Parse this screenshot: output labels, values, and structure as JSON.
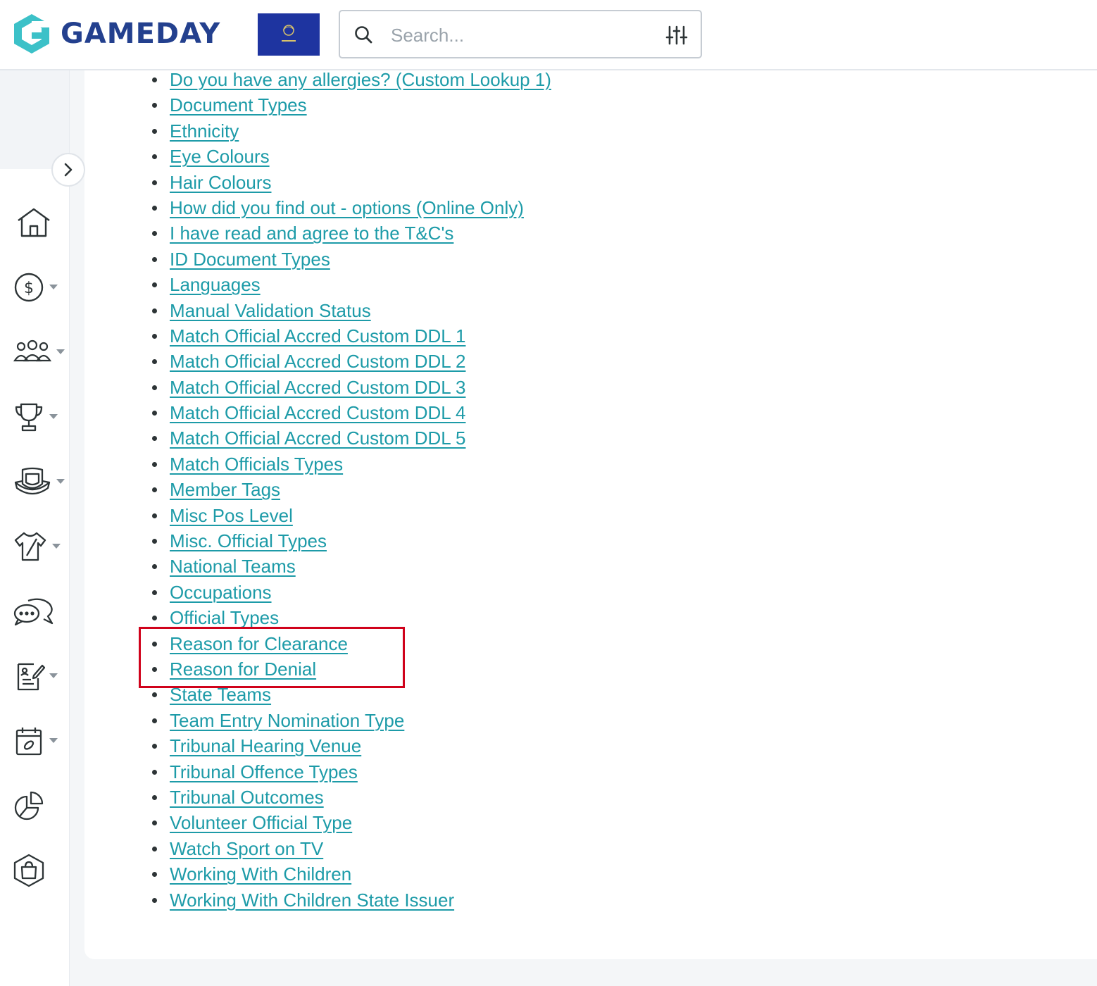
{
  "header": {
    "brand": "GAMEDAY",
    "search": {
      "placeholder": "Search...",
      "value": ""
    },
    "colors": {
      "brand": "#23408e",
      "accent": "#3cc1c8"
    }
  },
  "sidebar": {
    "toggle_icon": "chevron-right-icon",
    "items": [
      {
        "icon": "home-icon",
        "has_dropdown": false
      },
      {
        "icon": "dollar-icon",
        "has_dropdown": true
      },
      {
        "icon": "members-icon",
        "has_dropdown": true
      },
      {
        "icon": "trophy-icon",
        "has_dropdown": true
      },
      {
        "icon": "shield-icon",
        "has_dropdown": true
      },
      {
        "icon": "jersey-icon",
        "has_dropdown": true
      },
      {
        "icon": "chat-icon",
        "has_dropdown": false
      },
      {
        "icon": "form-icon",
        "has_dropdown": true
      },
      {
        "icon": "calendar-icon",
        "has_dropdown": true
      },
      {
        "icon": "pie-chart-icon",
        "has_dropdown": false
      },
      {
        "icon": "shopping-bag-icon",
        "has_dropdown": false
      }
    ]
  },
  "main": {
    "link_color": "#1d9ba8",
    "highlight_color": "#d0021b",
    "links": [
      "Do you have any allergies? (Custom Lookup 1)",
      "Document Types",
      "Ethnicity",
      "Eye Colours",
      "Hair Colours",
      "How did you find out - options (Online Only)",
      "I have read and agree to the T&C's",
      "ID Document Types",
      "Languages",
      "Manual Validation Status",
      "Match Official Accred Custom DDL 1",
      "Match Official Accred Custom DDL 2",
      "Match Official Accred Custom DDL 3",
      "Match Official Accred Custom DDL 4",
      "Match Official Accred Custom DDL 5",
      "Match Officials Types",
      "Member Tags",
      "Misc Pos Level",
      "Misc. Official Types",
      "National Teams",
      "Occupations",
      "Official Types",
      "Reason for Clearance",
      "Reason for Denial",
      "State Teams",
      "Team Entry Nomination Type",
      "Tribunal Hearing Venue",
      "Tribunal Offence Types",
      "Tribunal Outcomes",
      "Volunteer Official Type",
      "Watch Sport on TV",
      "Working With Children",
      "Working With Children State Issuer"
    ]
  }
}
